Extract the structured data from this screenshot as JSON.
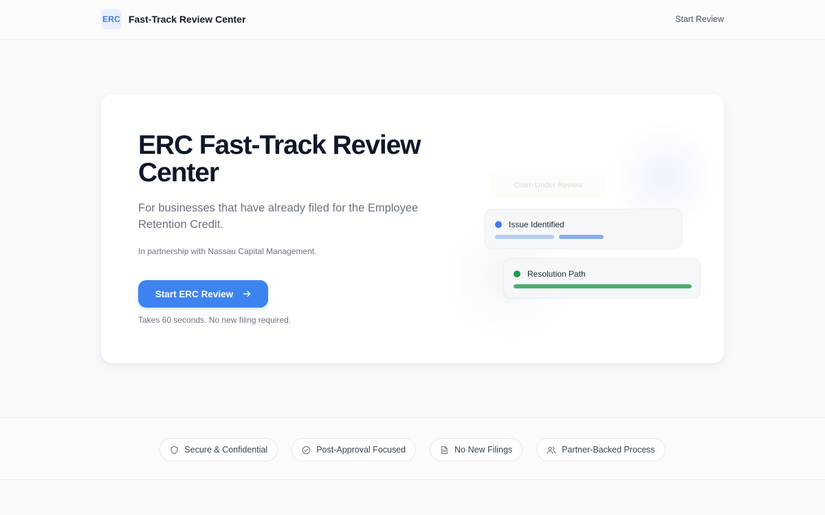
{
  "header": {
    "badge": "ERC",
    "title": "Fast-Track Review Center",
    "nav_link": "Start Review"
  },
  "hero": {
    "title": "ERC Fast-Track Review Center",
    "subtitle": "For businesses that have already filed for the Employee Retention Credit.",
    "partner": "In partnership with Nassau Capital Management.",
    "cta_label": "Start ERC Review",
    "cta_note": "Takes 60 seconds. No new filing required."
  },
  "illustration": {
    "ghost_label": "Claim Under Review",
    "cards": [
      {
        "label": "Issue Identified",
        "dot_color": "#3b7de9"
      },
      {
        "label": "Resolution Path",
        "dot_color": "#1e9b4f"
      }
    ]
  },
  "features": [
    {
      "icon": "shield-icon",
      "label": "Secure & Confidential"
    },
    {
      "icon": "check-circle-icon",
      "label": "Post-Approval Focused"
    },
    {
      "icon": "document-icon",
      "label": "No New Filings"
    },
    {
      "icon": "users-icon",
      "label": "Partner-Backed Process"
    }
  ],
  "colors": {
    "accent": "#3d84f0",
    "success": "#4caf6d",
    "background": "#f8f9fb"
  }
}
